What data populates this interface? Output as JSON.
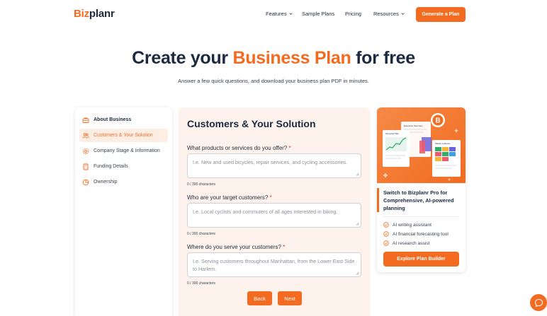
{
  "brand": {
    "part1": "Biz",
    "part2": "planr"
  },
  "nav": {
    "items": [
      {
        "label": "Features",
        "dropdown": true
      },
      {
        "label": "Sample Plans",
        "dropdown": false
      },
      {
        "label": "Pricing",
        "dropdown": false
      },
      {
        "label": "Resources",
        "dropdown": true
      }
    ],
    "cta_label": "Generate a Plan"
  },
  "hero": {
    "title_prefix": "Create your ",
    "title_highlight": "Business Plan",
    "title_suffix": " for free",
    "subtitle": "Answer a few quick questions, and download your business plan PDF in minutes."
  },
  "sidebar": {
    "items": [
      {
        "label": "About Business",
        "icon": "briefcase-icon"
      },
      {
        "label": "Customers & Your Solution",
        "icon": "users-icon"
      },
      {
        "label": "Company Stage & Information",
        "icon": "settings-icon"
      },
      {
        "label": "Funding Details",
        "icon": "calculator-icon"
      },
      {
        "label": "Ownership",
        "icon": "pie-chart-icon"
      }
    ],
    "active_index": 1
  },
  "form": {
    "title": "Customers & Your Solution",
    "questions": [
      {
        "label": "What products or services do you offer?",
        "required_mark": "*",
        "placeholder": "I.e. New and used bicycles, repair services, and cycling accessories.",
        "counter": "0 / 300 characters"
      },
      {
        "label": "Who are your target customers?",
        "required_mark": "*",
        "placeholder": "I.e. Local cyclists and commuters of all ages interested in biking.",
        "counter": "0 / 300 characters"
      },
      {
        "label": "Where do you serve your customers?",
        "required_mark": "*",
        "placeholder": "I.e. Serving customers throughout Manhattan, from the Lower East Side to Harlem.",
        "counter": "0 / 300 characters"
      }
    ],
    "back_label": "Back",
    "next_label": "Next"
  },
  "promo": {
    "illustration": {
      "doc1": "Executive Summary",
      "doc2": "Financial Plan",
      "doc3": "Market Analysis",
      "badge": "B"
    },
    "title": "Switch to Bizplanr Pro for Comprehensive, AI-powered planning",
    "features": [
      "AI writing assistant",
      "AI financial forecasting tool",
      "AI research assist"
    ],
    "cta_label": "Explore Plan Builder"
  },
  "colors": {
    "accent": "#f26b21",
    "heading": "#1b2a41",
    "form_bg": "#fdf3ec"
  }
}
